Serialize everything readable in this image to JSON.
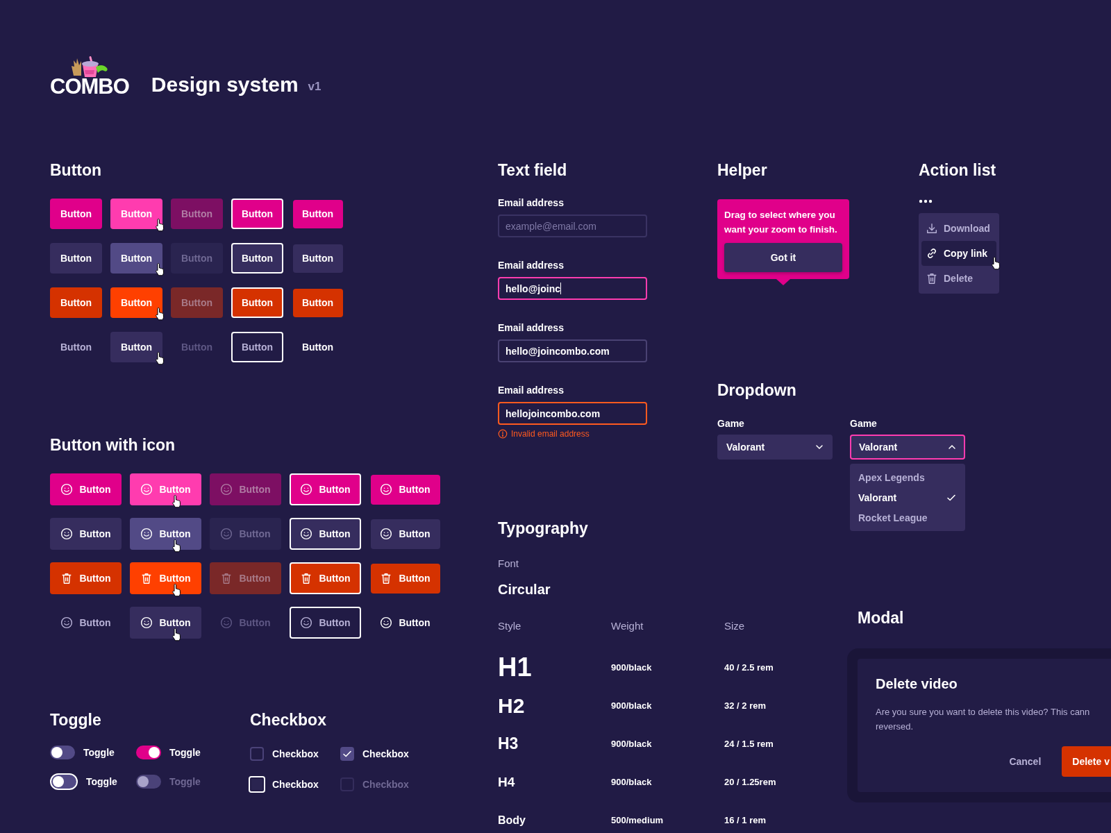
{
  "header": {
    "logo": "COMBO",
    "title": "Design system",
    "version": "v1"
  },
  "button_section": {
    "title": "Button",
    "rows": [
      {
        "kind": "primary",
        "buttons": [
          {
            "label": "Button",
            "hovered": false,
            "disabled": false,
            "focused": false,
            "pressed": false
          },
          {
            "label": "Button",
            "hovered": true,
            "disabled": false,
            "focused": false,
            "pressed": false
          },
          {
            "label": "Button",
            "hovered": false,
            "disabled": true,
            "focused": false,
            "pressed": false
          },
          {
            "label": "Button",
            "hovered": false,
            "disabled": false,
            "focused": true,
            "pressed": false
          },
          {
            "label": "Button",
            "hovered": false,
            "disabled": false,
            "focused": false,
            "pressed": true
          }
        ]
      },
      {
        "kind": "secondary",
        "buttons": [
          {
            "label": "Button",
            "hovered": false,
            "disabled": false,
            "focused": false,
            "pressed": false
          },
          {
            "label": "Button",
            "hovered": true,
            "disabled": false,
            "focused": false,
            "pressed": false
          },
          {
            "label": "Button",
            "hovered": false,
            "disabled": true,
            "focused": false,
            "pressed": false
          },
          {
            "label": "Button",
            "hovered": false,
            "disabled": false,
            "focused": true,
            "pressed": false
          },
          {
            "label": "Button",
            "hovered": false,
            "disabled": false,
            "focused": false,
            "pressed": true
          }
        ]
      },
      {
        "kind": "danger",
        "buttons": [
          {
            "label": "Button",
            "hovered": false,
            "disabled": false,
            "focused": false,
            "pressed": false
          },
          {
            "label": "Button",
            "hovered": true,
            "disabled": false,
            "focused": false,
            "pressed": false
          },
          {
            "label": "Button",
            "hovered": false,
            "disabled": true,
            "focused": false,
            "pressed": false
          },
          {
            "label": "Button",
            "hovered": false,
            "disabled": false,
            "focused": true,
            "pressed": false
          },
          {
            "label": "Button",
            "hovered": false,
            "disabled": false,
            "focused": false,
            "pressed": true
          }
        ]
      },
      {
        "kind": "ghost",
        "buttons": [
          {
            "label": "Button",
            "hovered": false,
            "disabled": false,
            "focused": false,
            "pressed": false
          },
          {
            "label": "Button",
            "hovered": true,
            "disabled": false,
            "focused": false,
            "pressed": false
          },
          {
            "label": "Button",
            "hovered": false,
            "disabled": true,
            "focused": false,
            "pressed": false
          },
          {
            "label": "Button",
            "hovered": false,
            "disabled": false,
            "focused": true,
            "pressed": false
          },
          {
            "label": "Button",
            "hovered": false,
            "disabled": false,
            "focused": false,
            "pressed": true
          }
        ]
      }
    ]
  },
  "icon_button_section": {
    "title": "Button with icon",
    "rows": [
      {
        "kind": "primary",
        "buttons": [
          {
            "label": "Button",
            "hovered": false,
            "disabled": false,
            "focused": false,
            "pressed": false
          },
          {
            "label": "Button",
            "hovered": true,
            "disabled": false,
            "focused": false,
            "pressed": false
          },
          {
            "label": "Button",
            "hovered": false,
            "disabled": true,
            "focused": false,
            "pressed": false
          },
          {
            "label": "Button",
            "hovered": false,
            "disabled": false,
            "focused": true,
            "pressed": false
          },
          {
            "label": "Button",
            "hovered": false,
            "disabled": false,
            "focused": false,
            "pressed": true
          }
        ]
      },
      {
        "kind": "secondary",
        "buttons": [
          {
            "label": "Button",
            "hovered": false,
            "disabled": false,
            "focused": false,
            "pressed": false
          },
          {
            "label": "Button",
            "hovered": true,
            "disabled": false,
            "focused": false,
            "pressed": false
          },
          {
            "label": "Button",
            "hovered": false,
            "disabled": true,
            "focused": false,
            "pressed": false
          },
          {
            "label": "Button",
            "hovered": false,
            "disabled": false,
            "focused": true,
            "pressed": false
          },
          {
            "label": "Button",
            "hovered": false,
            "disabled": false,
            "focused": false,
            "pressed": true
          }
        ]
      },
      {
        "kind": "danger",
        "buttons": [
          {
            "label": "Button",
            "hovered": false,
            "disabled": false,
            "focused": false,
            "pressed": false
          },
          {
            "label": "Button",
            "hovered": true,
            "disabled": false,
            "focused": false,
            "pressed": false
          },
          {
            "label": "Button",
            "hovered": false,
            "disabled": true,
            "focused": false,
            "pressed": false
          },
          {
            "label": "Button",
            "hovered": false,
            "disabled": false,
            "focused": true,
            "pressed": false
          },
          {
            "label": "Button",
            "hovered": false,
            "disabled": false,
            "focused": false,
            "pressed": true
          }
        ]
      },
      {
        "kind": "ghost",
        "buttons": [
          {
            "label": "Button",
            "hovered": false,
            "disabled": false,
            "focused": false,
            "pressed": false
          },
          {
            "label": "Button",
            "hovered": true,
            "disabled": false,
            "focused": false,
            "pressed": false
          },
          {
            "label": "Button",
            "hovered": false,
            "disabled": true,
            "focused": false,
            "pressed": false
          },
          {
            "label": "Button",
            "hovered": false,
            "disabled": false,
            "focused": true,
            "pressed": false
          },
          {
            "label": "Button",
            "hovered": false,
            "disabled": false,
            "focused": false,
            "pressed": true
          }
        ]
      }
    ]
  },
  "toggle_section": {
    "title": "Toggle",
    "items": [
      {
        "label": "Toggle",
        "on": false,
        "focused": false,
        "disabled": false
      },
      {
        "label": "Toggle",
        "on": true,
        "focused": false,
        "disabled": false
      },
      {
        "label": "Toggle",
        "on": false,
        "focused": true,
        "disabled": false
      },
      {
        "label": "Toggle",
        "on": false,
        "focused": false,
        "disabled": true
      }
    ]
  },
  "checkbox_section": {
    "title": "Checkbox",
    "items": [
      {
        "label": "Checkbox",
        "checked": false,
        "focused": false,
        "disabled": false
      },
      {
        "label": "Checkbox",
        "checked": true,
        "focused": false,
        "disabled": false
      },
      {
        "label": "Checkbox",
        "checked": false,
        "focused": true,
        "disabled": false
      },
      {
        "label": "Checkbox",
        "checked": false,
        "focused": false,
        "disabled": true
      }
    ]
  },
  "text_field_section": {
    "title": "Text field",
    "fields": [
      {
        "label": "Email address",
        "placeholder": "example@email.com",
        "focused": false,
        "invalid": false
      },
      {
        "label": "Email address",
        "value": "hello@joinc",
        "focused": true,
        "invalid": false
      },
      {
        "label": "Email address",
        "value": "hello@joincombo.com",
        "focused": false,
        "invalid": false
      },
      {
        "label": "Email address",
        "value": "hellojoincombo.com",
        "focused": false,
        "invalid": true,
        "error": "Invalid email address"
      }
    ]
  },
  "typography_section": {
    "title": "Typography",
    "font_label": "Font",
    "font_name": "Circular",
    "columns": [
      "Style",
      "Weight",
      "Size"
    ],
    "rows": [
      {
        "kind": "h1",
        "style": "H1",
        "weight": "900/black",
        "size": "40 / 2.5 rem"
      },
      {
        "kind": "h2",
        "style": "H2",
        "weight": "900/black",
        "size": "32 / 2 rem"
      },
      {
        "kind": "h3",
        "style": "H3",
        "weight": "900/black",
        "size": "24 / 1.5 rem"
      },
      {
        "kind": "h4",
        "style": "H4",
        "weight": "900/black",
        "size": "20 / 1.25rem"
      },
      {
        "kind": "body",
        "style": "Body",
        "weight": "500/medium",
        "size": "16 / 1 rem"
      }
    ]
  },
  "helper_section": {
    "title": "Helper",
    "message": "Drag to select where you want your zoom to finish.",
    "button": "Got it"
  },
  "action_list_section": {
    "title": "Action list",
    "items": [
      {
        "kind": "download",
        "label": "Download",
        "hovered": false
      },
      {
        "kind": "link",
        "label": "Copy link",
        "hovered": true
      },
      {
        "kind": "delete",
        "label": "Delete",
        "hovered": false
      }
    ]
  },
  "dropdown_section": {
    "title": "Dropdown",
    "dropdowns": [
      {
        "label": "Game",
        "value": "Valorant",
        "expanded": false
      },
      {
        "label": "Game",
        "value": "Valorant",
        "expanded": true,
        "options": [
          {
            "label": "Apex Legends",
            "selected": false
          },
          {
            "label": "Valorant",
            "selected": true
          },
          {
            "label": "Rocket League",
            "selected": false
          }
        ]
      }
    ]
  },
  "modal_section": {
    "title": "Modal",
    "dialog": {
      "title": "Delete video",
      "message_lines": [
        "Are you sure you want to delete this video? This cann",
        "reversed."
      ],
      "cancel": "Cancel",
      "confirm": "Delete v"
    }
  }
}
